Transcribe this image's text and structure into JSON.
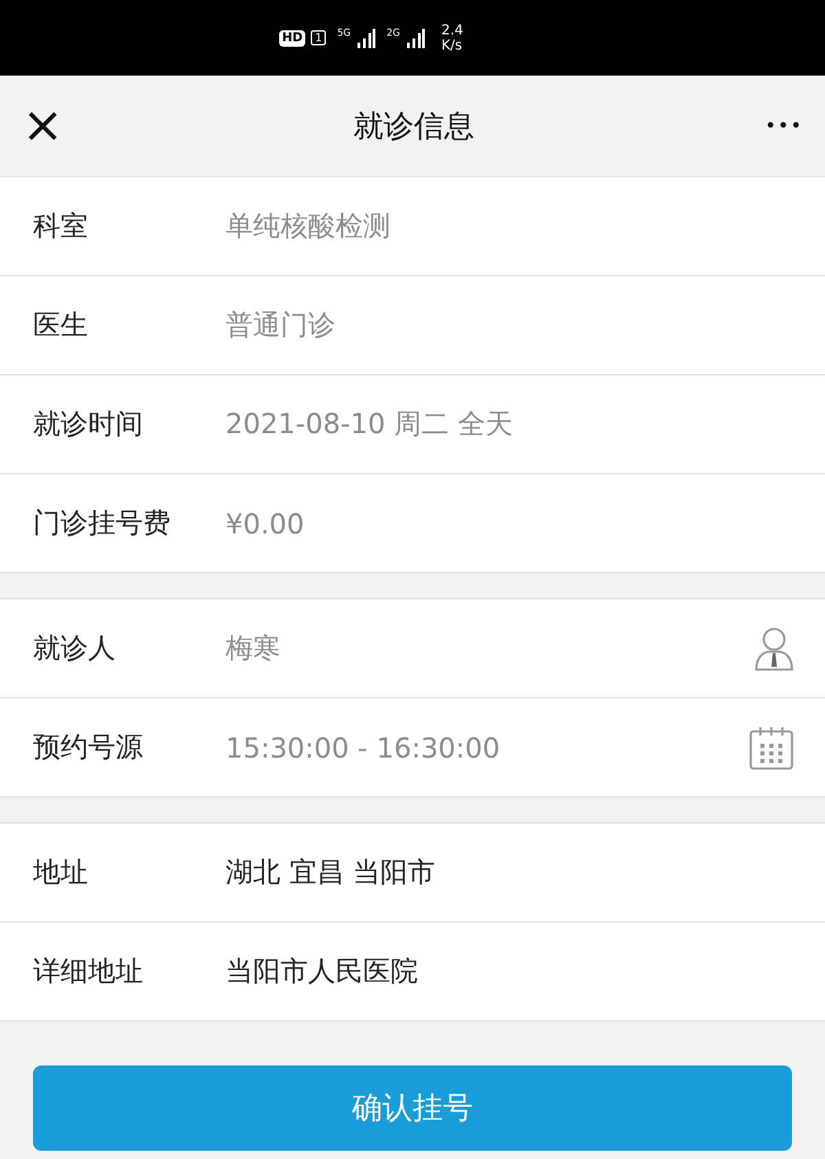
{
  "status_bar": {
    "hd": "HD",
    "sim": "1",
    "network_1": "5G",
    "network_2": "2G",
    "speed_value": "2.4",
    "speed_unit": "K/s"
  },
  "header": {
    "close": "×",
    "title": "就诊信息",
    "more": "•••"
  },
  "sections": [
    {
      "rows": [
        {
          "kind": "text",
          "label": "科室",
          "value": "单纯核酸检测",
          "dim": true
        },
        {
          "kind": "text",
          "label": "医生",
          "value": "普通门诊",
          "dim": true
        },
        {
          "kind": "text",
          "label": "就诊时间",
          "value": "2021-08-10 周二 全天",
          "dim": true
        },
        {
          "kind": "text",
          "label": "门诊挂号费",
          "value": "¥0.00",
          "dim": true
        }
      ]
    },
    {
      "rows": [
        {
          "kind": "person",
          "label": "就诊人",
          "value": "梅寒",
          "dim": true
        },
        {
          "kind": "calendar",
          "label": "预约号源",
          "value": "15:30:00 - 16:30:00",
          "dim": true
        }
      ]
    },
    {
      "rows": [
        {
          "kind": "text",
          "label": "地址",
          "value": "湖北 宜昌 当阳市",
          "dim": false
        },
        {
          "kind": "text",
          "label": "详细地址",
          "value": "当阳市人民医院",
          "dim": false
        }
      ]
    }
  ],
  "confirm_button": "确认挂号"
}
